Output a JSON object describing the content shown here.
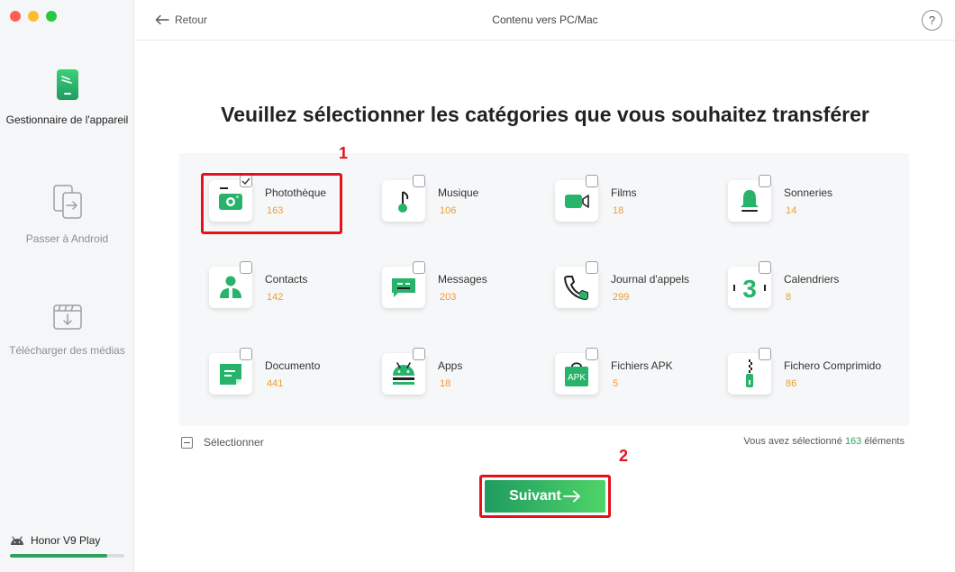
{
  "window": {
    "title": "Contenu vers PC/Mac",
    "back_label": "Retour",
    "help_label": "?"
  },
  "sidebar": {
    "items": [
      {
        "label": "Gestionnaire de l'appareil",
        "icon": "phone-icon",
        "active": true
      },
      {
        "label": "Passer à Android",
        "icon": "transfer-icon",
        "active": false
      },
      {
        "label": "Télécharger des médias",
        "icon": "download-media-icon",
        "active": false
      }
    ],
    "device": {
      "name": "Honor V9 Play",
      "storage_fraction": 0.85
    }
  },
  "main": {
    "heading": "Veuillez sélectionner les catégories que vous souhaitez transférer",
    "categories": [
      {
        "name": "Photothèque",
        "count": "163",
        "icon": "camera-icon",
        "checked": true
      },
      {
        "name": "Musique",
        "count": "106",
        "icon": "music-note-icon",
        "checked": false
      },
      {
        "name": "Films",
        "count": "18",
        "icon": "video-camera-icon",
        "checked": false
      },
      {
        "name": "Sonneries",
        "count": "14",
        "icon": "bell-icon",
        "checked": false
      },
      {
        "name": "Contacts",
        "count": "142",
        "icon": "contacts-icon",
        "checked": false
      },
      {
        "name": "Messages",
        "count": "203",
        "icon": "message-icon",
        "checked": false
      },
      {
        "name": "Journal d'appels",
        "count": "299",
        "icon": "phone-call-icon",
        "checked": false
      },
      {
        "name": "Calendriers",
        "count": "8",
        "icon": "calendar-icon",
        "checked": false
      },
      {
        "name": "Documento",
        "count": "441",
        "icon": "document-icon",
        "checked": false
      },
      {
        "name": "Apps",
        "count": "18",
        "icon": "android-app-icon",
        "checked": false
      },
      {
        "name": "Fichiers APK",
        "count": "5",
        "icon": "apk-icon",
        "checked": false
      },
      {
        "name": "Fichero Comprimido",
        "count": "86",
        "icon": "zip-icon",
        "checked": false
      }
    ],
    "calendar_glyph": "3",
    "apk_glyph": "APK",
    "select_all_label": "Sélectionner",
    "selected_info": {
      "prefix": "Vous avez sélectionné ",
      "count": "163",
      "suffix": " éléments"
    },
    "next_label": "Suivant",
    "annotations": {
      "step1": "1",
      "step2": "2"
    }
  },
  "colors": {
    "brand_green": "#2fa05e",
    "count_orange": "#f39b2b",
    "annotation_red": "#e3121b"
  }
}
